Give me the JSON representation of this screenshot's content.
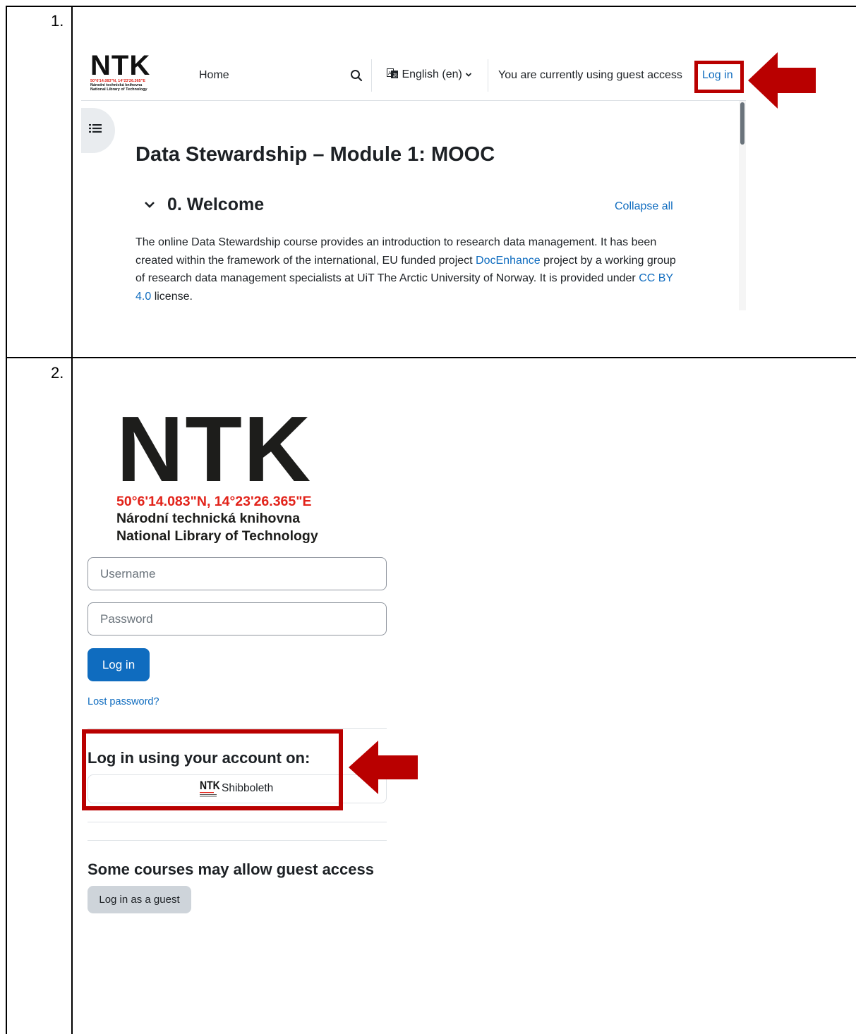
{
  "steps": {
    "one": "1.",
    "two": "2."
  },
  "header": {
    "logo_text": "NTK",
    "logo_coords": "50°6'14.083\"N, 14°23'26.365\"E",
    "logo_line1": "Národní technická knihovna",
    "logo_line2": "National Library of Technology",
    "home": "Home",
    "language": "English (en)",
    "guest_notice": "You are currently using guest access",
    "login": "Log in"
  },
  "course": {
    "title": "Data Stewardship – Module 1: MOOC",
    "section_title": "0. Welcome",
    "collapse_all": "Collapse all",
    "desc_part1": "The online Data Stewardship course provides an introduction to research data management. It has been created within the framework of the international, EU funded project ",
    "desc_link1": "DocEnhance",
    "desc_part2": " project by a working group of research data management specialists at UiT The Arctic University of Norway. It is provided under ",
    "desc_link2": "CC BY 4.0",
    "desc_part3": " license."
  },
  "login_page": {
    "logo_text": "NTK",
    "logo_coords": "50°6'14.083\"N, 14°23'26.365\"E",
    "logo_line1": "Národní technická knihovna",
    "logo_line2": "National Library of Technology",
    "username_placeholder": "Username",
    "password_placeholder": "Password",
    "login_button": "Log in",
    "lost_password": "Lost password?",
    "idp_title": "Log in using your account on:",
    "idp_logo_text": "NTK",
    "idp_label": "Shibboleth",
    "guest_title": "Some courses may allow guest access",
    "guest_button": "Log in as a guest"
  },
  "colors": {
    "accent": "#0f6cbf",
    "highlight": "#b90000",
    "ntk_red": "#e2231a"
  }
}
